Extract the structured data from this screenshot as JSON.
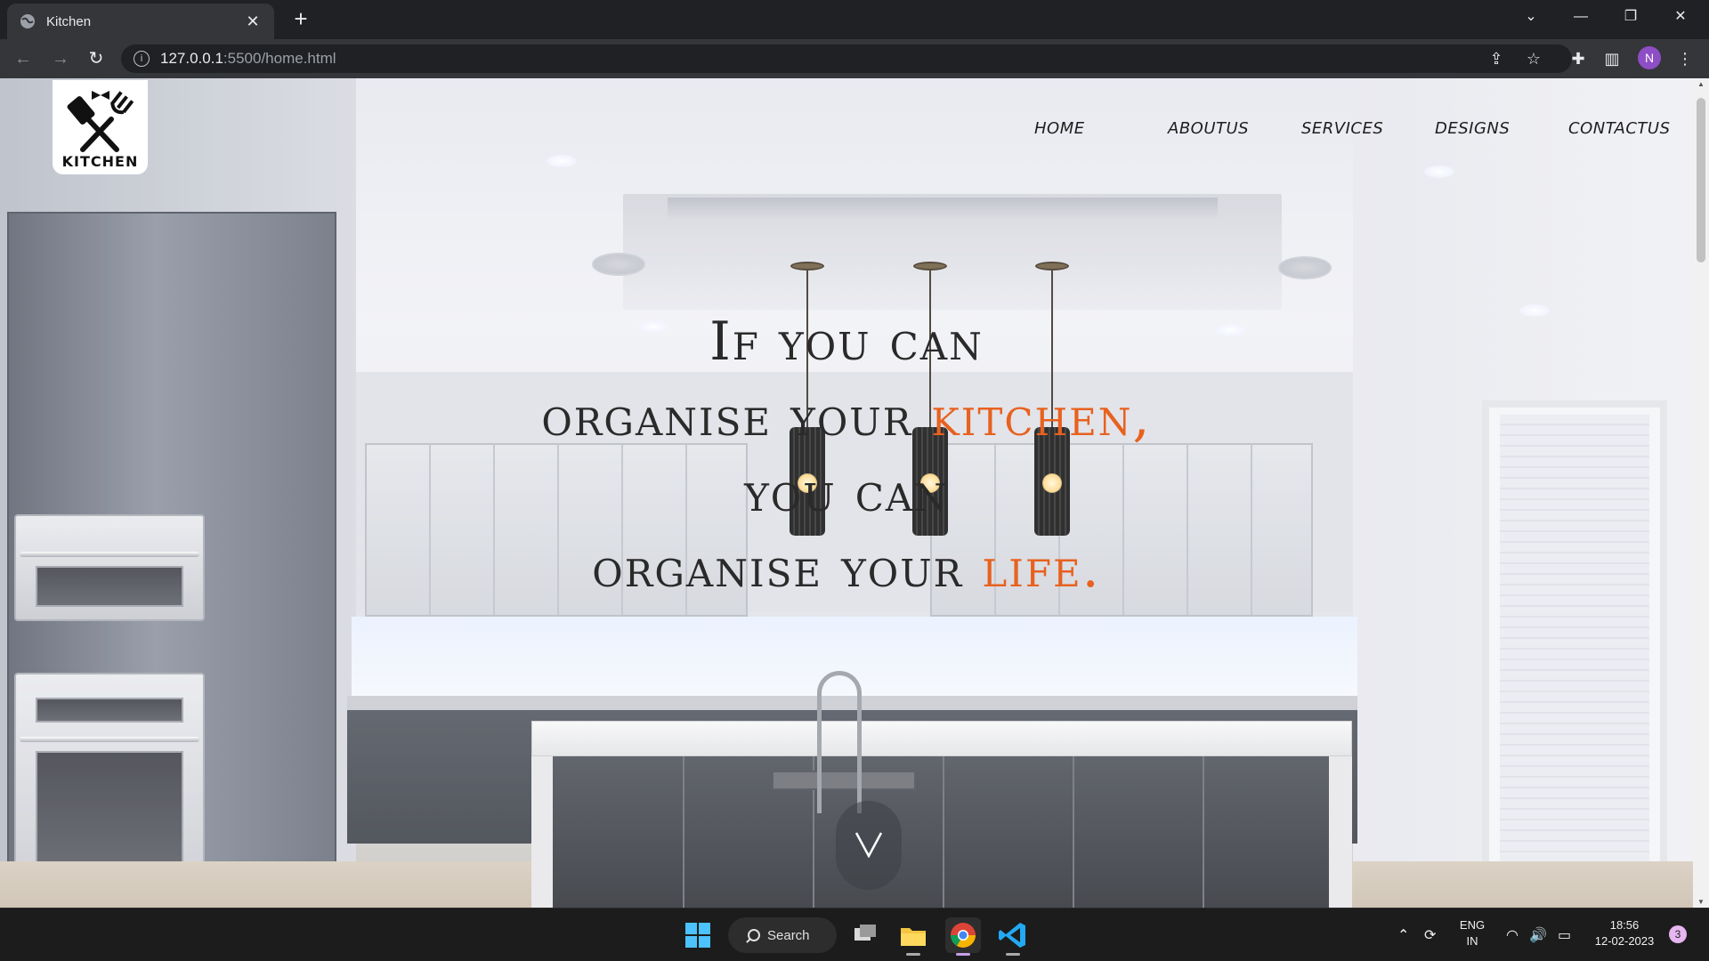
{
  "browser": {
    "tab_title": "Kitchen",
    "tab_close": "✕",
    "new_tab": "+",
    "url_host": "127.0.0.1",
    "url_path": ":5500/home.html",
    "profile_initial": "N",
    "info_icon": "i"
  },
  "site": {
    "logo_text": "KITCHEN",
    "nav": [
      "HOME",
      "ABOUTUS",
      "SERVICES",
      "DESIGNS",
      "CONTACTUS"
    ],
    "hero": {
      "line1": "If you can",
      "line2_a": "organise your ",
      "line2_b": "kitchen,",
      "line3": "you can",
      "line4_a": "organise your ",
      "line4_b": "life."
    },
    "accent_color": "#e8611f"
  },
  "taskbar": {
    "search_label": "Search",
    "lang_top": "ENG",
    "lang_bottom": "IN",
    "time": "18:56",
    "date": "12-02-2023",
    "notification_count": "3"
  }
}
